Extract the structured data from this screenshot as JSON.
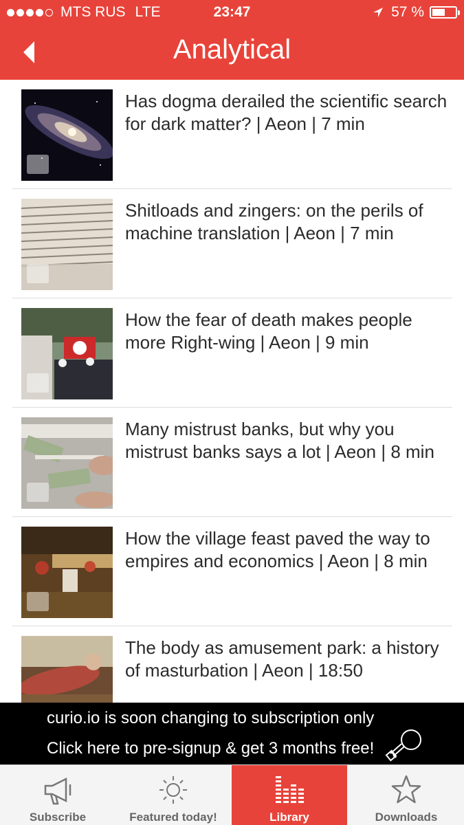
{
  "status_bar": {
    "carrier": "MTS RUS",
    "network": "LTE",
    "time": "23:47",
    "battery": "57 %",
    "battery_level": 0.57
  },
  "header": {
    "title": "Analytical",
    "back_icon": "back-arrow-icon",
    "color": "#e8433a"
  },
  "articles": [
    {
      "title": "Has dogma derailed the scientific search for dark matter? | Aeon | 7 min",
      "thumb": "galaxy"
    },
    {
      "title": "Shitloads and zingers: on the perils of machine translation | Aeon | 7 min",
      "thumb": "dictionary"
    },
    {
      "title": "How the fear of death makes people more Right-wing | Aeon | 9 min",
      "thumb": "rally"
    },
    {
      "title": "Many mistrust banks, but why you mistrust banks says a lot | Aeon | 8 min",
      "thumb": "money"
    },
    {
      "title": "How the village feast paved the way to empires and economics | Aeon | 8 min",
      "thumb": "feast-painting"
    },
    {
      "title": "The body as amusement park: a history of masturbation | Aeon | 18:50",
      "thumb": "reclining-figure"
    }
  ],
  "banner": {
    "line1": "curio.io is soon changing to subscription only",
    "line2": "Click here to pre-signup & get 3 months free!",
    "icon": "lightbulb-icon"
  },
  "tabs": [
    {
      "label": "Subscribe",
      "icon": "megaphone-icon",
      "active": false
    },
    {
      "label": "Featured today!",
      "icon": "sun-icon",
      "active": false
    },
    {
      "label": "Library",
      "icon": "equalizer-icon",
      "active": true
    },
    {
      "label": "Downloads",
      "icon": "star-icon",
      "active": false
    }
  ]
}
